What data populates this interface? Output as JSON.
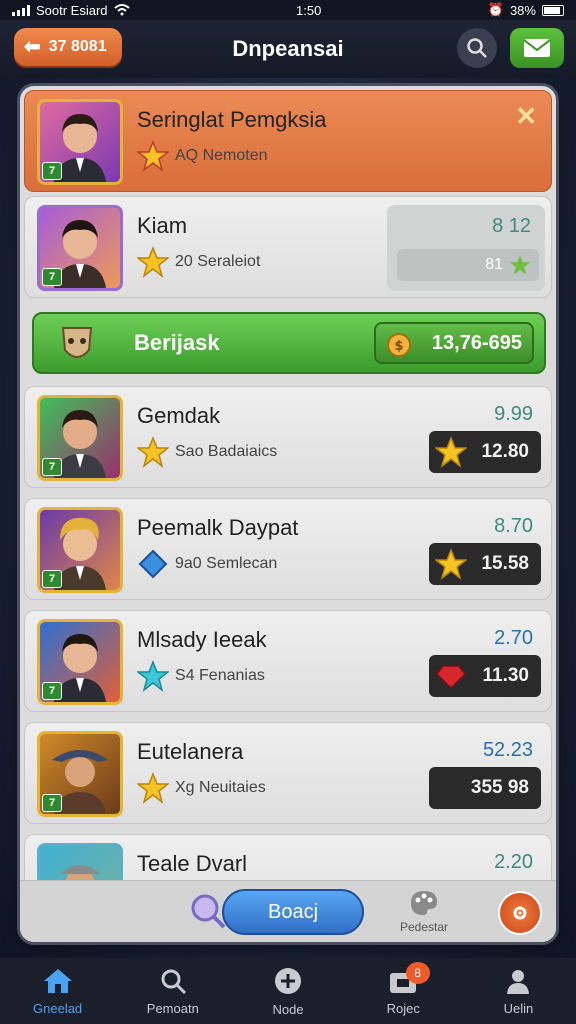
{
  "status_bar": {
    "carrier": "Sootr Esiard",
    "time": "1:50",
    "battery": "38%"
  },
  "header": {
    "back_label": "37 8081",
    "title": "Dnpeansai"
  },
  "rows": [
    {
      "name": "Seringlat Pemgksia",
      "sub": "AQ Nemoten",
      "type": "header-row"
    },
    {
      "name": "Kiam",
      "sub": "20 Seraleiot",
      "score_top": "8 12",
      "score_bottom": "81"
    },
    {
      "name": "Gemdak",
      "sub": "Sao Badaiaics",
      "score_top": "9.99",
      "score_bottom": "12.80"
    },
    {
      "name": "Peemalk Daypat",
      "sub": "9a0 Semlecan",
      "score_top": "8.70",
      "score_bottom": "15.58"
    },
    {
      "name": "Mlsady Ieeak",
      "sub": "S4 Fenanias",
      "score_top": "2.70",
      "score_bottom": "11.30"
    },
    {
      "name": "Eutelanera",
      "sub": "Xg Neuitaies",
      "score_top": "52.23",
      "score_bottom": "355 98"
    },
    {
      "name": "Teale Dvarl",
      "score_top": "2.20"
    }
  ],
  "highlight_bar": {
    "label": "Berijask",
    "value": "13,76-695"
  },
  "actions": {
    "board_label": "Boacj",
    "pedestal_label": "Pedestar"
  },
  "nav": [
    {
      "label": "Gneelad"
    },
    {
      "label": "Pemoatn"
    },
    {
      "label": "Node"
    },
    {
      "label": "Rojec",
      "badge": "8"
    },
    {
      "label": "Uelin"
    }
  ],
  "colors": {
    "orange": "#d86e3a",
    "green": "#3c9c2c",
    "blue": "#2f6fc8",
    "panel": "#dcdcdc"
  }
}
